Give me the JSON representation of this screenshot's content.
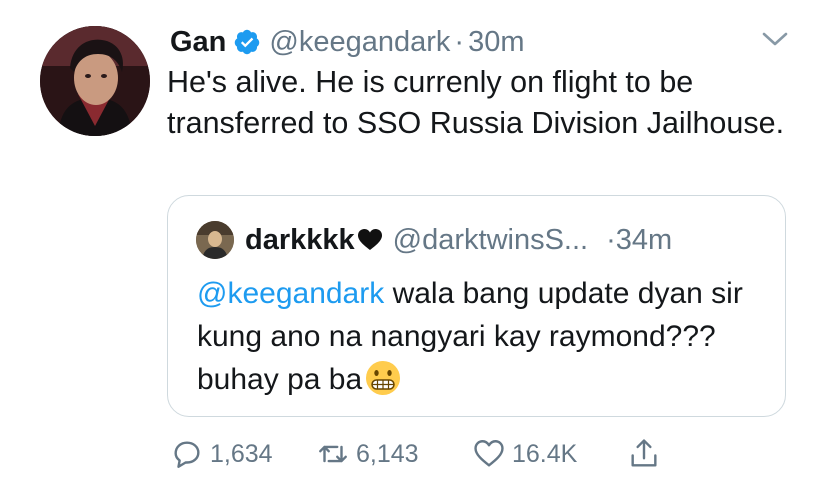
{
  "tweet": {
    "display_name": "Gan",
    "handle": "@keegandark",
    "separator": "·",
    "time": "30m",
    "text": "He's alive. He is currenly on flight to be transferred to SSO Russia Division Jailhouse.",
    "avatar_icon": "user-avatar-photo",
    "verified_icon": "verified-badge-icon",
    "menu_icon": "chevron-down-icon"
  },
  "quoted": {
    "display_name": "darkkkk",
    "name_emoji": "black-heart-icon",
    "handle": "@darktwinsS...",
    "separator": "·",
    "time": "34m",
    "mention": "@keegandark",
    "text": " wala bang update dyan sir kung ano na nangyari kay raymond??? buhay pa ba",
    "trailing_emoji": "grimacing-face-emoji"
  },
  "actions": {
    "reply_count": "1,634",
    "retweet_count": "6,143",
    "like_count": "16.4K",
    "reply_icon": "reply-icon",
    "retweet_icon": "retweet-icon",
    "like_icon": "heart-icon",
    "share_icon": "share-icon"
  },
  "colors": {
    "text": "#14171a",
    "secondary": "#657786",
    "accent": "#1d9bf0",
    "border": "#cfd9de"
  }
}
